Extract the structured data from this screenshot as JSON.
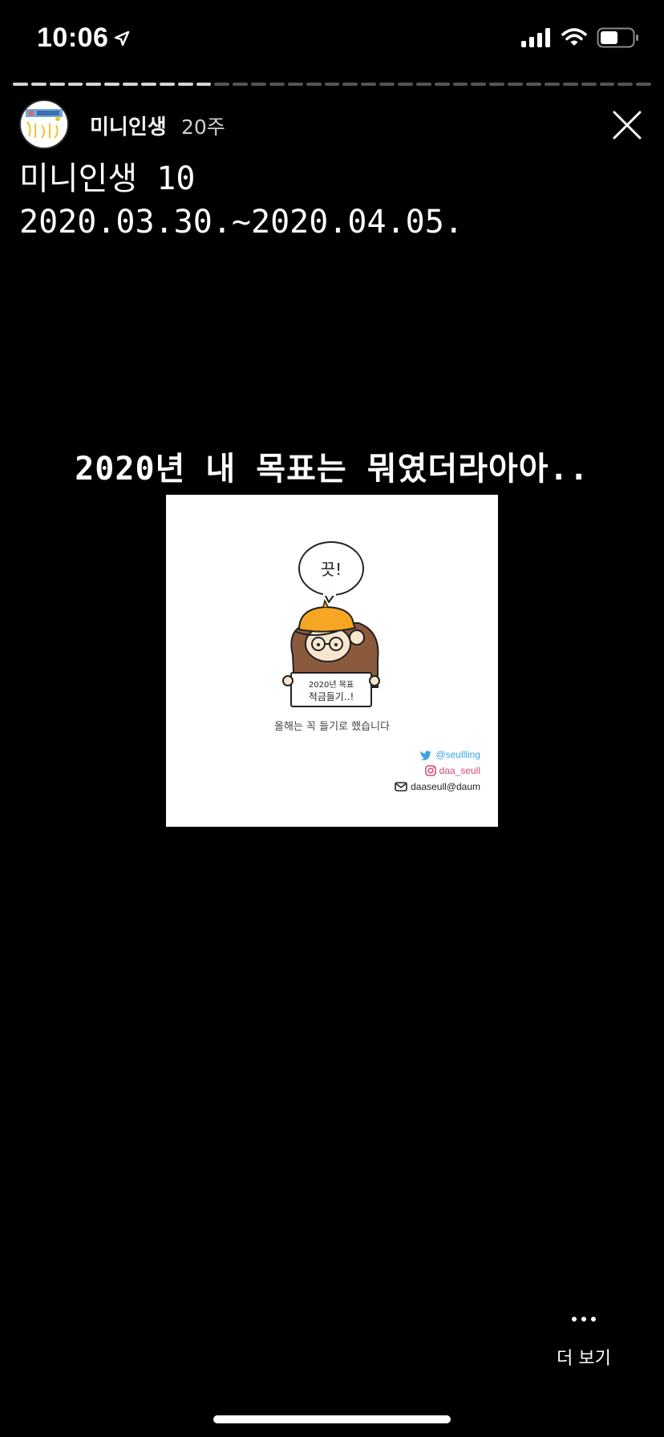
{
  "status_bar": {
    "time": "10:06",
    "icons": [
      "location-arrow-icon",
      "cellular-signal-icon",
      "wifi-icon",
      "battery-icon"
    ],
    "battery_level": 0.55
  },
  "progress": {
    "total_segments": 35,
    "seen_segments": 11
  },
  "header": {
    "username": "미니인생",
    "timestamp": "20주",
    "avatar_text": "미니인생"
  },
  "story": {
    "title_line1": "미니인생 10",
    "title_line2": "2020.03.30.~2020.04.05.",
    "caption": "2020년 내 목표는 뭐였더라아아.."
  },
  "post_image": {
    "speech_text": "끗!",
    "sign_line1": "2020년 목표",
    "sign_line2": "적금들기..!",
    "caption": "올해는 꼭 들기로 했습니다",
    "twitter_handle": "@seullling",
    "instagram_handle": "daa_seull",
    "email": "daaseull@daum",
    "colors": {
      "hat": "#f6a623",
      "hair": "#8b5a3c",
      "twitter": "#3aa3e3",
      "instagram": "#d24a7d"
    }
  },
  "footer": {
    "more_label": "더 보기"
  }
}
